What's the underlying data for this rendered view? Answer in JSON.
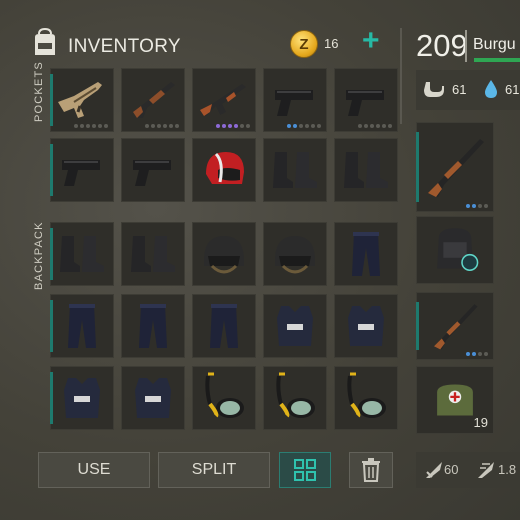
{
  "header": {
    "title": "INVENTORY",
    "coins": "16",
    "add_label": "+"
  },
  "sections": {
    "pockets": "POCKETS",
    "backpack": "BACKPACK"
  },
  "character": {
    "health": "209",
    "name": "Burgu",
    "food": "61",
    "water": "61"
  },
  "buttons": {
    "use": "USE",
    "split": "SPLIT"
  },
  "grid": {
    "pockets": [
      [
        "assault-rifle-desert",
        "shotgun",
        "ak-rifle",
        "pistol",
        "pistol"
      ],
      [
        "pistol",
        "pistol",
        "red-helmet",
        "black-boots",
        "black-boots"
      ]
    ],
    "backpack": [
      [
        "black-boots",
        "black-boots",
        "tactical-helmet",
        "tactical-helmet",
        "police-pants"
      ],
      [
        "police-pants",
        "police-pants",
        "police-pants",
        "police-vest",
        "police-vest"
      ],
      [
        "police-vest",
        "police-vest",
        "snorkel-mask",
        "snorkel-mask",
        "snorkel-mask"
      ]
    ]
  },
  "equipment": [
    {
      "item": "hunting-rifle"
    },
    {
      "item": "backpack"
    },
    {
      "item": "hunting-rifle"
    },
    {
      "item": "first-aid-bag",
      "quantity": "19"
    }
  ],
  "weapon_stats": {
    "attack": "60",
    "speed": "1.8"
  },
  "colors": {
    "accent": "#27b9a5",
    "health_bar": "#2fa653",
    "coin": "#e5a81c"
  }
}
